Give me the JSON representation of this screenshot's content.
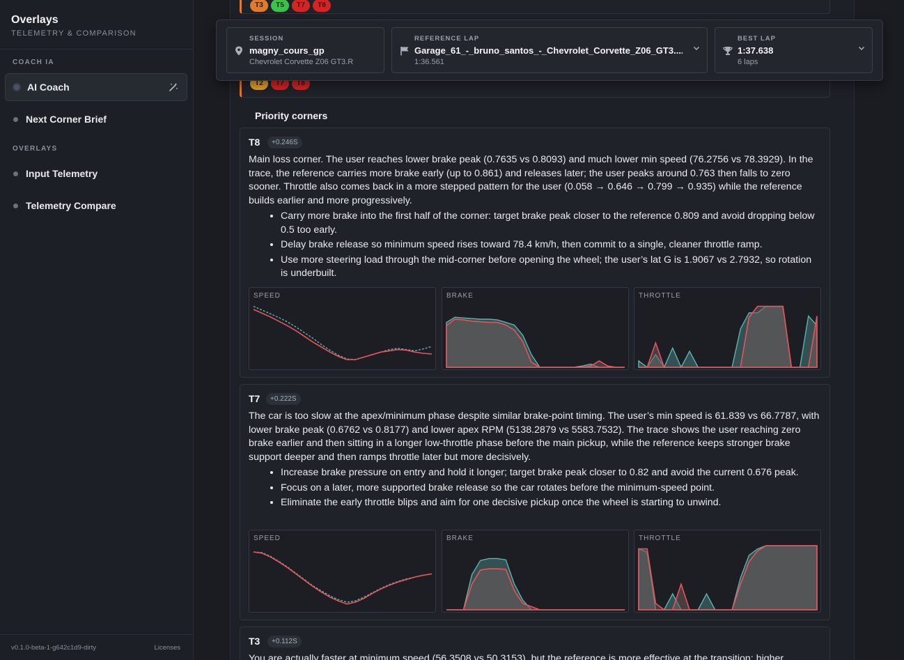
{
  "sidebar": {
    "title": "Overlays",
    "subtitle": "TELEMETRY & COMPARISON",
    "section_coach": "COACH IA",
    "section_overlays": "OVERLAYS",
    "items": [
      {
        "label": "AI Coach"
      },
      {
        "label": "Next Corner Brief"
      },
      {
        "label": "Input Telemetry"
      },
      {
        "label": "Telemetry Compare"
      }
    ],
    "version": "v0.1.0-beta-1-g642c1d9-dirty",
    "licenses": "Licenses"
  },
  "header": {
    "session_caption": "SESSION",
    "session_value": "magny_cours_gp",
    "session_sub": "Chevrolet Corvette Z06 GT3.R",
    "reference_caption": "REFERENCE LAP",
    "reference_value": "Garage_61_-_bruno_santos_-_Chevrolet_Corvette_Z06_GT3....",
    "reference_sub": "1:36.561",
    "best_caption": "BEST LAP",
    "best_value": "1:37.638",
    "best_sub": "6 laps"
  },
  "top_chips": [
    {
      "label": "T3",
      "color": "#e07a2c"
    },
    {
      "label": "T5",
      "color": "#3cc24a"
    },
    {
      "label": "T7",
      "color": "#d42424"
    },
    {
      "label": "T8",
      "color": "#d42424"
    }
  ],
  "second_chips": [
    {
      "label": "T2",
      "color": "#e0a030"
    },
    {
      "label": "T7",
      "color": "#d42424"
    },
    {
      "label": "T8",
      "color": "#d42424"
    }
  ],
  "priority_title": "Priority corners",
  "chart_labels": {
    "speed": "SPEED",
    "brake": "BRAKE",
    "throttle": "THROTTLE"
  },
  "colors": {
    "user": "#e8545a",
    "reference": "#5fb3b0"
  },
  "corners": [
    {
      "name": "T8",
      "delta": "+0.246S",
      "description": "Main loss corner. The user reaches lower brake peak (0.7635 vs 0.8093) and much lower min speed (76.2756 vs 78.3929). In the trace, the reference carries more brake early (up to 0.861) and releases later; the user peaks around 0.763 then falls to zero sooner. Throttle also comes back in a more stepped pattern for the user (0.058 → 0.646 → 0.799 → 0.935) while the reference builds earlier and more progressively.",
      "tips": [
        "Carry more brake into the first half of the corner: target brake peak closer to the reference 0.809 and avoid dropping below 0.5 too early.",
        "Delay brake release so minimum speed rises toward 78.4 km/h, then commit to a single, cleaner throttle ramp.",
        "Use more steering load through the mid-corner before opening the wheel; the user’s lat G is 1.9067 vs 2.7932, so rotation is underbuilt."
      ]
    },
    {
      "name": "T7",
      "delta": "+0.222S",
      "description": "The car is too slow at the apex/minimum phase despite similar brake-point timing. The user’s min speed is 61.839 vs 66.7787, with lower brake peak (0.6762 vs 0.8177) and lower apex RPM (5138.2879 vs 5583.7532). The trace shows the user reaching zero brake earlier and then sitting in a longer low-throttle phase before the main pickup, while the reference keeps stronger brake support deeper and then ramps throttle later but more decisively.",
      "tips": [
        "Increase brake pressure on entry and hold it longer; target brake peak closer to 0.82 and avoid the current 0.676 peak.",
        "Focus on a later, more supported brake release so the car rotates before the minimum-speed point.",
        "Eliminate the early throttle blips and aim for one decisive pickup once the wheel is starting to unwind."
      ]
    },
    {
      "name": "T3",
      "delta": "+0.112S",
      "description": "You are actually faster at minimum speed (56.3508 vs 50.3153), but the reference is more effective at the transition; higher"
    }
  ]
}
